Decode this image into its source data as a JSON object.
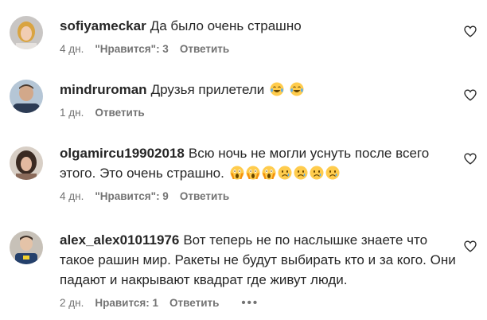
{
  "comments": [
    {
      "username": "sofiyameckar",
      "text": "Да было очень страшно",
      "time": "4 дн.",
      "likes": "\"Нравится\": 3",
      "reply": "Ответить",
      "emojis": []
    },
    {
      "username": "mindruroman",
      "text": "Друзья прилетели",
      "time": "1 дн.",
      "reply": "Ответить",
      "emojis": [
        "tears-of-joy-emoji",
        "tears-of-joy-emoji"
      ]
    },
    {
      "username": "olgamircu19902018",
      "text": "Всю ночь не могли уснуть после всего этого. Это очень страшно.",
      "time": "4 дн.",
      "likes": "\"Нравится\": 9",
      "reply": "Ответить",
      "emojis": [
        "screaming-face-emoji",
        "screaming-face-emoji",
        "screaming-face-emoji",
        "sad-face-emoji",
        "sad-face-emoji",
        "sad-face-emoji",
        "sad-face-emoji"
      ]
    },
    {
      "username": "alex_alex01011976",
      "text": "Вот теперь не по наслышке знаете что такое рашин мир. Ракеты не будут выбирать кто и за кого. Они падают и накрывают квадрат где живут люди.",
      "time": "2 дн.",
      "likes": "Нравится: 1",
      "reply": "Ответить",
      "more": "•••",
      "emojis": []
    }
  ],
  "icons": {
    "like": "heart-outline-icon",
    "more": "more-options-icon"
  },
  "colors": {
    "text": "#262626",
    "secondary": "#737373",
    "emoji_yellow": "#FFCC4D",
    "emoji_tear": "#5DADEC"
  }
}
